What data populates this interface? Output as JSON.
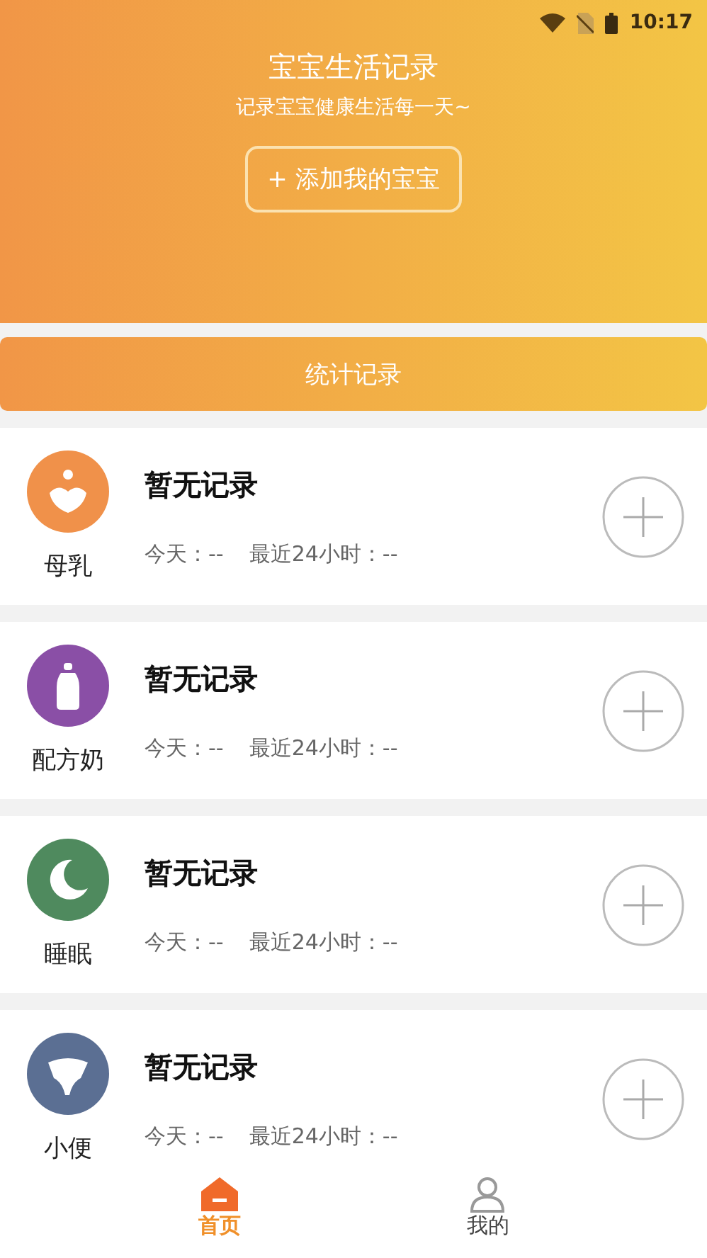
{
  "status_bar": {
    "time": "10:17"
  },
  "header": {
    "title": "宝宝生活记录",
    "subtitle": "记录宝宝健康生活每一天~",
    "add_button": "+ 添加我的宝宝"
  },
  "stats_button": "统计记录",
  "records": [
    {
      "kind": "breast",
      "label": "母乳",
      "color": "#f0914a",
      "title": "暂无记录",
      "today": "今天：--",
      "last24": "最近24小时：--"
    },
    {
      "kind": "bottle",
      "label": "配方奶",
      "color": "#8a4fa6",
      "title": "暂无记录",
      "today": "今天：--",
      "last24": "最近24小时：--"
    },
    {
      "kind": "sleep",
      "label": "睡眠",
      "color": "#4f8a5e",
      "title": "暂无记录",
      "today": "今天：--",
      "last24": "最近24小时：--"
    },
    {
      "kind": "diaper",
      "label": "小便",
      "color": "#5b6f93",
      "title": "暂无记录",
      "today": "今天：--",
      "last24": "最近24小时：--"
    }
  ],
  "tabs": [
    {
      "label": "首页",
      "kind": "home",
      "selected": true
    },
    {
      "label": "我的",
      "kind": "profile",
      "selected": false
    }
  ]
}
